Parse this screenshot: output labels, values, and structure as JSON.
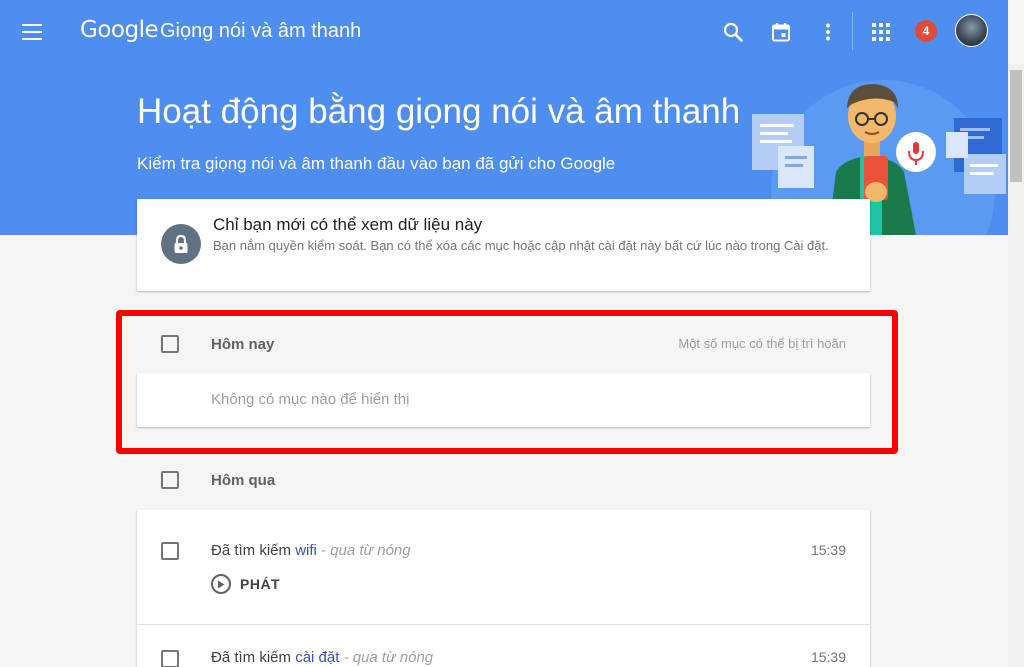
{
  "header": {
    "logo": "Google",
    "app_title": "Giọng nói và âm thanh",
    "notification_count": "4",
    "icons": [
      "menu-icon",
      "search-icon",
      "calendar-icon",
      "more-vert-icon",
      "apps-icon",
      "avatar"
    ]
  },
  "hero": {
    "title": "Hoạt động bằng giọng nói và âm thanh",
    "subtitle": "Kiểm tra giọng nói và âm thanh đầu vào bạn đã gửi cho Google"
  },
  "privacy": {
    "title": "Chỉ bạn mới có thể xem dữ liệu này",
    "text": "Bạn nắm quyền kiểm soát. Bạn có thể xóa các mục hoặc cập nhật cài đặt này bất cứ lúc nào trong Cài đặt."
  },
  "today": {
    "label": "Hôm nay",
    "note": "Một số mục có thể bị trì hoãn",
    "empty": "Không có mục nào để hiển thị"
  },
  "yesterday": {
    "label": "Hôm qua",
    "items": [
      {
        "prefix": "Đã tìm kiếm",
        "term": "wifi",
        "via": "- qua từ nóng",
        "time": "15:39",
        "play": "PHÁT"
      },
      {
        "prefix": "Đã tìm kiếm",
        "term": "cài đặt",
        "via": "- qua từ nóng",
        "time": "15:39"
      }
    ]
  },
  "colors": {
    "hero_bg": "#4d8ef0",
    "highlight": "#ff0000",
    "badge": "#dd4b39",
    "term_link": "#3f51b5"
  }
}
